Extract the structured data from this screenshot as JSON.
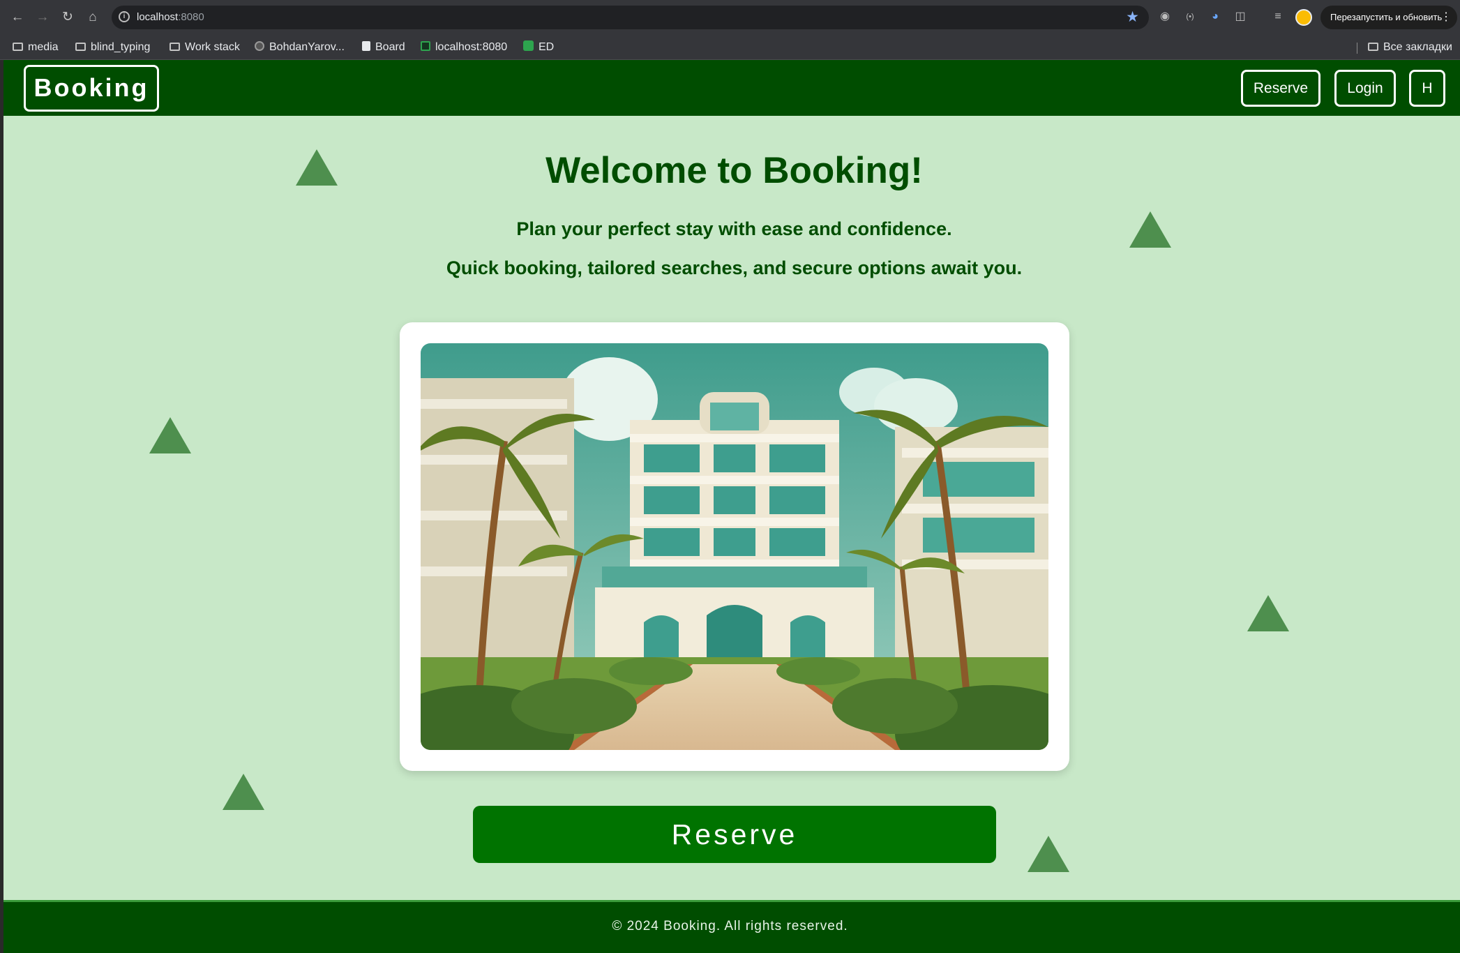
{
  "browser": {
    "url_host": "localhost",
    "url_port": ":8080",
    "restart_label": "Перезапустить и обновить",
    "bookmarks": [
      {
        "label": "media",
        "icon": "folder-icon"
      },
      {
        "label": "blind_typing",
        "icon": "folder-icon"
      },
      {
        "label": "Work stack",
        "icon": "folder-icon"
      },
      {
        "label": "BohdanYarov...",
        "icon": "github-icon"
      },
      {
        "label": "Board",
        "icon": "trello-icon"
      },
      {
        "label": "localhost:8080",
        "icon": "site-icon"
      },
      {
        "label": "ED",
        "icon": "ed-icon"
      }
    ],
    "all_bookmarks_label": "Все закладки"
  },
  "header": {
    "logo": "Booking",
    "buttons": [
      "Reserve",
      "Login",
      "H"
    ]
  },
  "hero": {
    "title": "Welcome to Booking!",
    "line1": "Plan your perfect stay with ease and confidence.",
    "line2": "Quick booking, tailored searches, and secure options await you.",
    "image_alt": "Illustrated hotel with palm trees"
  },
  "cta": {
    "reserve_label": "Reserve"
  },
  "footer": {
    "text": "© 2024 Booking. All rights reserved."
  },
  "colors": {
    "header_bg": "#004d00",
    "page_bg": "#c8e8c8",
    "cta_bg": "#007300",
    "triangle": "#4e8f4e"
  }
}
